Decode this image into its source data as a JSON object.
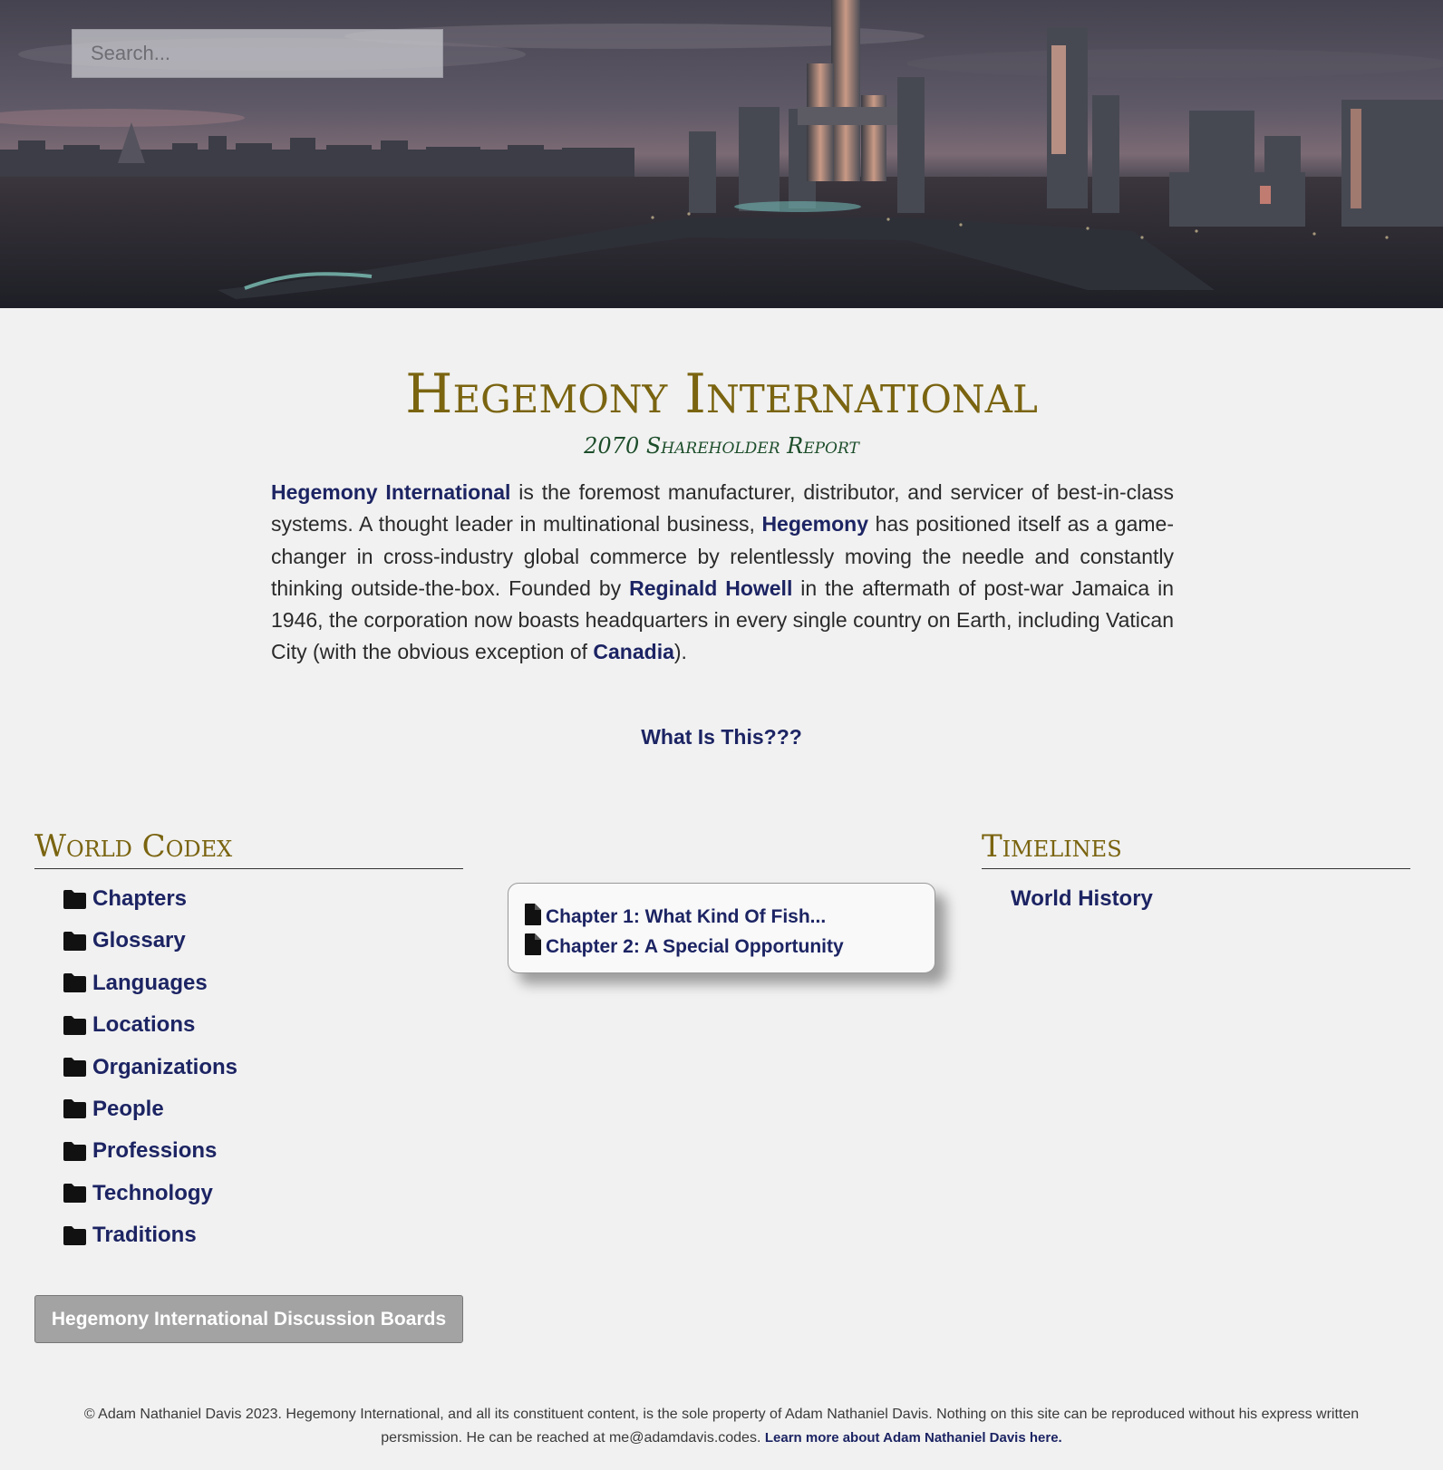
{
  "search": {
    "placeholder": "Search..."
  },
  "header": {
    "title": "Hegemony International",
    "subtitle": "2070 Shareholder Report"
  },
  "intro": {
    "link_hegemony_international": "Hegemony International",
    "text_1": " is the foremost manufacturer, distributor, and servicer of best-in-class systems. A thought leader in multinational business, ",
    "link_hegemony": "Hegemony",
    "text_2": " has positioned itself as a game-changer in cross-industry global commerce by relentlessly moving the needle and constantly thinking outside-the-box. Founded by ",
    "link_reginald": "Reginald Howell",
    "text_3": " in the aftermath of post-war Jamaica in 1946, the corporation now boasts headquarters in every single country on Earth, including Vatican City (with the obvious exception of ",
    "link_canadia": "Canadia",
    "text_4": ")."
  },
  "what_link": "What Is This???",
  "codex": {
    "heading": "World Codex",
    "items": [
      {
        "label": "Chapters",
        "icon": "folder-icon"
      },
      {
        "label": "Glossary",
        "icon": "folder-icon"
      },
      {
        "label": "Languages",
        "icon": "folder-icon"
      },
      {
        "label": "Locations",
        "icon": "folder-icon"
      },
      {
        "label": "Organizations",
        "icon": "folder-icon"
      },
      {
        "label": "People",
        "icon": "folder-icon"
      },
      {
        "label": "Professions",
        "icon": "folder-icon"
      },
      {
        "label": "Technology",
        "icon": "folder-icon"
      },
      {
        "label": "Traditions",
        "icon": "folder-icon"
      }
    ],
    "discussion_button": "Hegemony International Discussion Boards"
  },
  "chapters": [
    {
      "label": "Chapter 1: What Kind Of Fish...",
      "icon": "file-icon"
    },
    {
      "label": "Chapter 2: A Special Opportunity",
      "icon": "file-icon"
    }
  ],
  "timelines": {
    "heading": "Timelines",
    "items": [
      {
        "label": "World History"
      }
    ]
  },
  "footer": {
    "text": "© Adam Nathaniel Davis 2023. Hegemony International, and all its constituent content, is the sole property of Adam Nathaniel Davis. Nothing on this site can be reproduced without his express written persmission. He can be reached at me@adamdavis.codes. ",
    "link": "Learn more about Adam Nathaniel Davis here."
  },
  "colors": {
    "title_gold": "#7a6410",
    "subtitle_green": "#1c4d2a",
    "link_navy": "#1c2463",
    "background": "#f1f1f1"
  }
}
